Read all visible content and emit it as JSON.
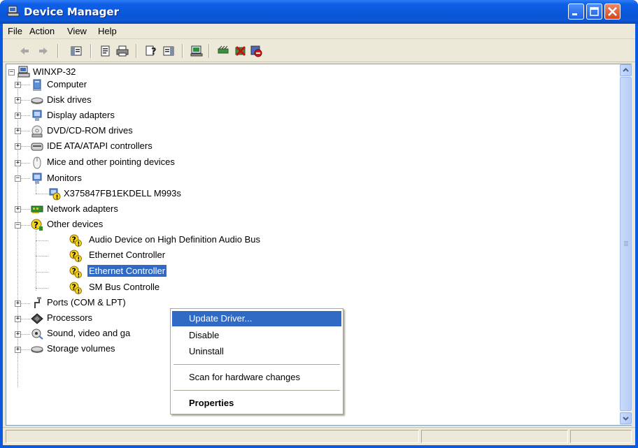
{
  "window": {
    "title": "Device Manager",
    "buttons": {
      "minimize": "minimize",
      "maximize": "maximize",
      "close": "close"
    }
  },
  "menubar": {
    "items": [
      "File",
      "Action",
      "View",
      "Help"
    ]
  },
  "toolbar": {
    "icons": [
      "back-icon",
      "forward-icon",
      "show-hide-console-tree-icon",
      "properties-icon",
      "print-icon",
      "help-icon",
      "show-hide-action-pane-icon",
      "update-driver-icon",
      "scan-hardware-icon",
      "uninstall-icon",
      "disable-icon"
    ]
  },
  "tree": {
    "root": "WINXP-32",
    "nodes": [
      {
        "label": "Computer",
        "expanded": false,
        "icon": "computer-icon"
      },
      {
        "label": "Disk drives",
        "expanded": false,
        "icon": "disk-drive-icon"
      },
      {
        "label": "Display adapters",
        "expanded": false,
        "icon": "display-adapter-icon"
      },
      {
        "label": "DVD/CD-ROM drives",
        "expanded": false,
        "icon": "cdrom-icon"
      },
      {
        "label": "IDE ATA/ATAPI controllers",
        "expanded": false,
        "icon": "ide-controller-icon"
      },
      {
        "label": "Mice and other pointing devices",
        "expanded": false,
        "icon": "mouse-icon"
      },
      {
        "label": "Monitors",
        "expanded": true,
        "icon": "monitor-icon",
        "children": [
          {
            "label": "X375847FB1EKDELL M993s",
            "icon": "monitor-warning-icon"
          }
        ]
      },
      {
        "label": "Network adapters",
        "expanded": false,
        "icon": "network-adapter-icon"
      },
      {
        "label": "Other devices",
        "expanded": true,
        "icon": "unknown-device-icon",
        "children": [
          {
            "label": "Audio Device on High Definition Audio Bus",
            "icon": "unknown-device-warning-icon"
          },
          {
            "label": "Ethernet Controller",
            "icon": "unknown-device-warning-icon"
          },
          {
            "label": "Ethernet Controller",
            "icon": "unknown-device-warning-icon",
            "selected": true
          },
          {
            "label": "SM Bus Controlle",
            "icon": "unknown-device-warning-icon"
          }
        ]
      },
      {
        "label": "Ports (COM & LPT)",
        "expanded": false,
        "icon": "port-icon"
      },
      {
        "label": "Processors",
        "expanded": false,
        "icon": "processor-icon"
      },
      {
        "label": "Sound, video and ga",
        "expanded": false,
        "icon": "sound-icon"
      },
      {
        "label": "Storage volumes",
        "expanded": false,
        "icon": "storage-volume-icon"
      }
    ]
  },
  "context_menu": {
    "items": [
      {
        "label": "Update Driver...",
        "highlighted": true
      },
      {
        "label": "Disable"
      },
      {
        "label": "Uninstall"
      },
      {
        "separator": true
      },
      {
        "label": "Scan for hardware changes"
      },
      {
        "separator": true
      },
      {
        "label": "Properties",
        "bold": true
      }
    ]
  },
  "colors": {
    "titlebar": "#0a56d8",
    "selection": "#316ac5",
    "face": "#ece9d8",
    "warning": "#f7d51e"
  }
}
